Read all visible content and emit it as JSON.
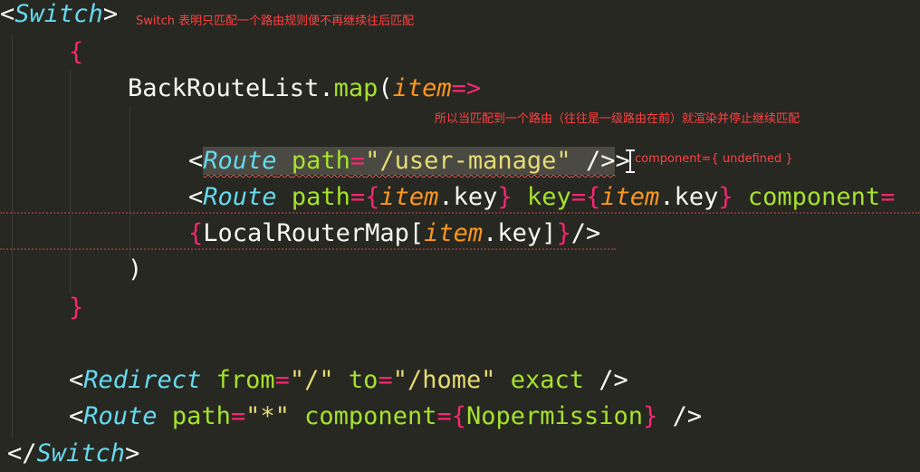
{
  "code": {
    "switch_open": "Switch",
    "open_brace": "{",
    "map_obj": "BackRouteList",
    "map_dot": ".",
    "map_fn": "map",
    "map_paren": "(",
    "map_param": "item",
    "map_arrow": "=>",
    "route1_tag": "Route",
    "route1_attr": "path",
    "route1_eq": "=",
    "route1_val": "\"/user-manage\"",
    "route1_close": " />",
    "route2_tag": "Route",
    "route2_attr_path": "path",
    "route2_item1": "item",
    "route2_key1": ".key",
    "route2_attr_key": "key",
    "route2_item2": "item",
    "route2_key2": ".key",
    "route2_attr_component": "component",
    "route2_eq": "=",
    "line3_ident": "LocalRouterMap",
    "line3_bracket_open": "[",
    "line3_item": "item",
    "line3_key": ".key",
    "line3_bracket_close": "]",
    "line3_close": "/>",
    "close_paren": ")",
    "close_brace": "}",
    "redirect_tag": "Redirect",
    "redirect_from_attr": "from",
    "redirect_from_val": "\"/\"",
    "redirect_to_attr": "to",
    "redirect_to_val": "\"/home\"",
    "redirect_exact": "exact",
    "route3_tag": "Route",
    "route3_path_attr": "path",
    "route3_path_val": "\"*\"",
    "route3_component_attr": "component",
    "route3_component_val": "Nopermission",
    "switch_close": "Switch"
  },
  "annotations": {
    "switch_note": "Switch 表明只匹配一个路由规则便不再继续往后匹配",
    "match_note": "所以当匹配到一个路由（往往是一级路由在前）就渲染并停止继续匹配",
    "component_note": "component={ undefined }"
  },
  "colors": {
    "background": "#272822",
    "keyword": "#f92672",
    "component": "#66d9ef",
    "attribute": "#a6e22e",
    "string": "#e6db74",
    "parameter": "#fd971f",
    "annotation": "#ff4040"
  }
}
